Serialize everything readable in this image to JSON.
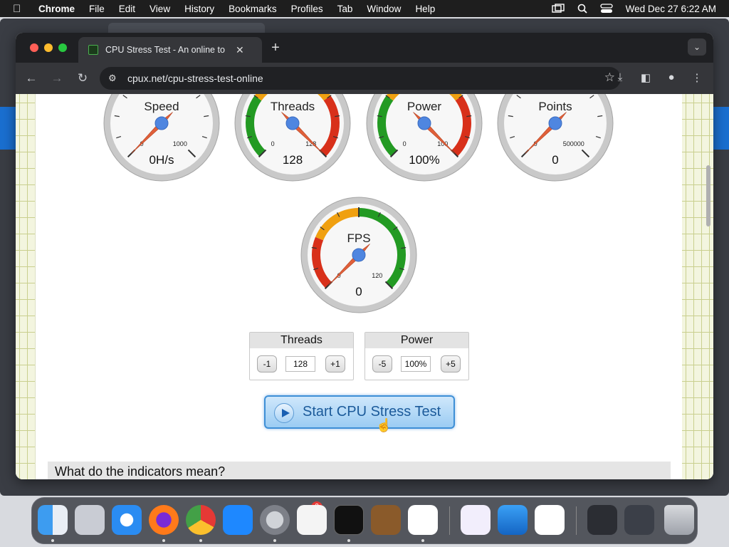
{
  "menubar": {
    "app_name": "Chrome",
    "items": [
      "File",
      "Edit",
      "View",
      "History",
      "Bookmarks",
      "Profiles",
      "Tab",
      "Window",
      "Help"
    ],
    "clock": "Wed Dec 27  6:22 AM"
  },
  "browser": {
    "tab_title": "CPU Stress Test - An online to",
    "url": "cpux.net/cpu-stress-test-online"
  },
  "gauges": [
    {
      "label": "Speed",
      "value_text": "0H/s",
      "min_label": "0",
      "max_label": "1000",
      "needle_fraction": 0
    },
    {
      "label": "Threads",
      "value_text": "128",
      "min_label": "0",
      "max_label": "128",
      "needle_fraction": 1
    },
    {
      "label": "Power",
      "value_text": "100%",
      "min_label": "0",
      "max_label": "100",
      "needle_fraction": 1
    },
    {
      "label": "Points",
      "value_text": "0",
      "min_label": "0",
      "max_label": "500000",
      "needle_fraction": 0
    },
    {
      "label": "FPS",
      "value_text": "0",
      "min_label": "0",
      "max_label": "120",
      "needle_fraction": 0
    }
  ],
  "controls": {
    "threads": {
      "title": "Threads",
      "dec": "-1",
      "value": "128",
      "inc": "+1"
    },
    "power": {
      "title": "Power",
      "dec": "-5",
      "value": "100%",
      "inc": "+5"
    }
  },
  "start_button": "Start CPU Stress Test",
  "section_heading": "What do the indicators mean?",
  "dock": {
    "apps": [
      "finder",
      "launchpad",
      "safari",
      "firefox",
      "chrome",
      "app-store",
      "system-settings",
      "textedit",
      "terminal",
      "garageband",
      "vscode",
      "visual-studio",
      "icloud",
      "news",
      "window-preview",
      "window-preview-2",
      "trash"
    ],
    "settings_badge": "2"
  }
}
